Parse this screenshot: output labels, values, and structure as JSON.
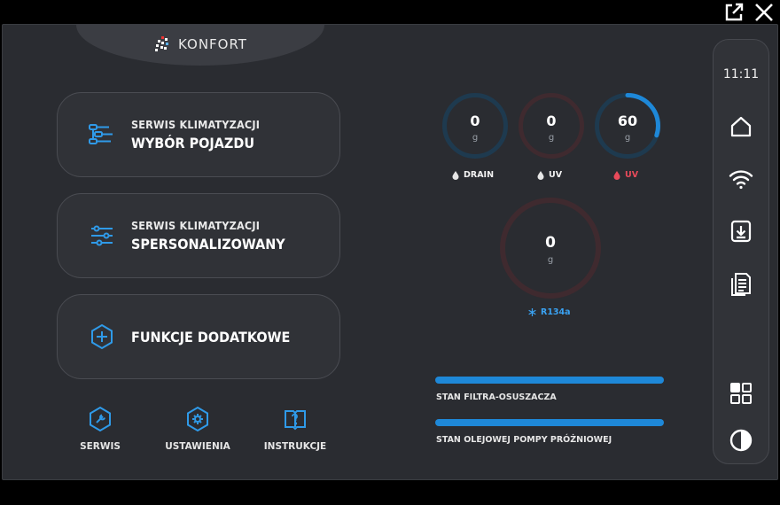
{
  "header": {
    "brand": "KONFORT"
  },
  "menu": [
    {
      "line1": "SERWIS KLIMATYZACJI",
      "line2": "WYBÓR POJAZDU",
      "icon": "vehicle-list-icon"
    },
    {
      "line1": "SERWIS KLIMATYZACJI",
      "line2": "SPERSONALIZOWANY",
      "icon": "sliders-icon"
    },
    {
      "line1": "",
      "line2": "FUNKCJE DODATKOWE",
      "icon": "plus-hexagon-icon"
    }
  ],
  "bottom_nav": [
    {
      "label": "SERWIS",
      "icon": "wrench-icon"
    },
    {
      "label": "USTAWIENIA",
      "icon": "gear-icon"
    },
    {
      "label": "INSTRUKCJE",
      "icon": "manual-icon"
    }
  ],
  "gauges": [
    {
      "value": "0",
      "unit": "g",
      "label": "DRAIN",
      "fill": 0,
      "ring_color": "#1e3a4f",
      "label_color": "#e6e6e6",
      "icon_color": "#e6e6e6"
    },
    {
      "value": "0",
      "unit": "g",
      "label": "UV",
      "fill": 0,
      "ring_color": "#3f2a2f",
      "label_color": "#e6e6e6",
      "icon_color": "#e6e6e6"
    },
    {
      "value": "60",
      "unit": "g",
      "label": "UV",
      "fill": 0.3,
      "ring_color": "#1e3a4f",
      "label_color": "#e84a5a",
      "icon_color": "#e84a5a"
    },
    {
      "value": "0",
      "unit": "g",
      "label": "R134a",
      "fill": 0,
      "ring_color": "#3f2a2f",
      "label_color": "#3aa2f2",
      "icon_color": "#3aa2f2"
    }
  ],
  "status_bars": [
    {
      "label": "STAN FILTRA-OSUSZACZA",
      "fill": 1
    },
    {
      "label": "STAN OLEJOWEJ POMPY PRÓŻNIOWEJ",
      "fill": 1
    }
  ],
  "sidebar": {
    "time": "11:11",
    "icons": [
      "home-icon",
      "wifi-icon",
      "download-icon",
      "documents-icon",
      "grid-icon",
      "contrast-icon"
    ]
  },
  "colors": {
    "accent": "#1e88d8",
    "background": "#2a2c31",
    "warning": "#e84a5a"
  }
}
